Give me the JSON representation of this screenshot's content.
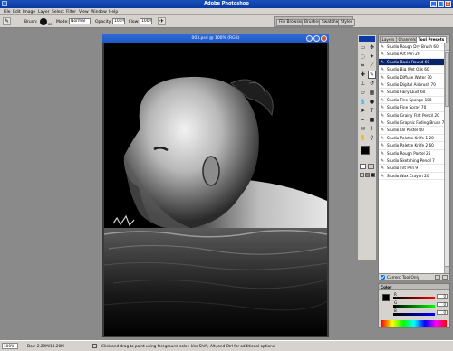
{
  "app": {
    "title": "Adobe Photoshop"
  },
  "menu": [
    "File",
    "Edit",
    "Image",
    "Layer",
    "Select",
    "Filter",
    "View",
    "Window",
    "Help"
  ],
  "options": {
    "brush_label": "Brush:",
    "brush_size": "60",
    "mode_label": "Mode:",
    "mode_value": "Normal",
    "opacity_label": "Opacity:",
    "opacity_value": "100%",
    "flow_label": "Flow:",
    "flow_value": "100%"
  },
  "palette_well": {
    "tabs": [
      "File Browser",
      "Brushes",
      "Swatches",
      "Styles"
    ]
  },
  "document": {
    "title": "003.psd @ 100% (RGB)"
  },
  "presets_panel": {
    "tabs": [
      "Layers",
      "Channels",
      "Tool Presets"
    ],
    "active_tab": "Tool Presets",
    "items": [
      "Studio Rough Dry Brush 60",
      "Studio Art Pen 20",
      "Studio Basic Round 60",
      "Studio Big Wet Oils 60",
      "Studio Diffuse Water 70",
      "Studio Digital Airbrush 70",
      "Studio Fairy Dust 60",
      "Studio Fine Sponge 100",
      "Studio Fine Spray 70",
      "Studio Grainy Flat Pencil 20",
      "Studio Graphic Fading Brush 70",
      "Studio Oil Pastel 40",
      "Studio Palette Knife 1 20",
      "Studio Palette Knife 2 60",
      "Studio Rough Pastel 25",
      "Studio Sketching Pencil 7",
      "Studio Tilt Pen 9",
      "Studio Wax Crayon 20"
    ],
    "selected_index": 2,
    "current_tool_only_label": "Current Tool Only"
  },
  "color_panel": {
    "tab": "Color",
    "channels": [
      "R",
      "G",
      "B"
    ],
    "values": [
      "0",
      "0",
      "0"
    ]
  },
  "status": {
    "zoom": "100%",
    "doc": "Doc: 2.29M/13.20M",
    "hint": "Click and drag to paint using foreground color. Use Shift, Alt, and Ctrl for additional options."
  },
  "colors": {
    "title_blue": "#0a3aa4",
    "selection": "#0a246a",
    "chrome": "#d6d3ce"
  },
  "icons": [
    "app-icon",
    "brush-icon",
    "minimize-icon",
    "maximize-icon",
    "close-icon",
    "airbrush-icon",
    "marquee-icon",
    "move-icon",
    "lasso-icon",
    "magic-wand-icon",
    "crop-icon",
    "slice-icon",
    "healing-icon",
    "brush-tool-icon",
    "stamp-icon",
    "history-brush-icon",
    "eraser-icon",
    "gradient-icon",
    "blur-icon",
    "dodge-icon",
    "path-select-icon",
    "type-icon",
    "pen-icon",
    "shape-icon",
    "notes-icon",
    "eyedropper-icon",
    "hand-icon",
    "zoom-icon"
  ]
}
